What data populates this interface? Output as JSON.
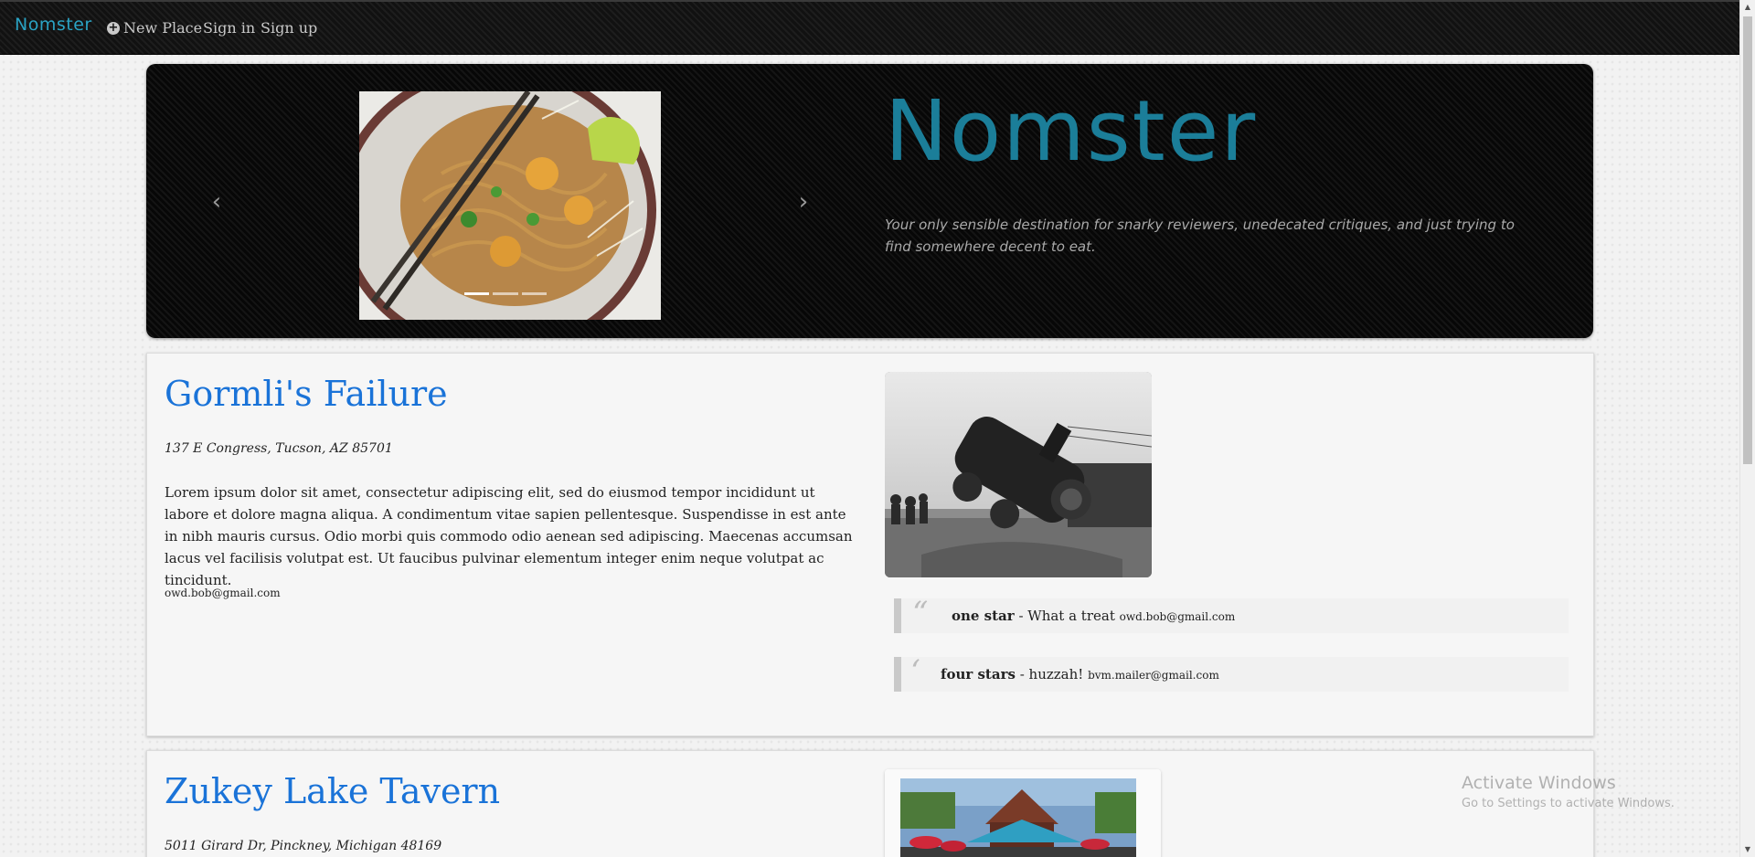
{
  "navbar": {
    "brand": "Nomster",
    "new_place": "New Place",
    "sign_in": "Sign in",
    "sign_up": "Sign up"
  },
  "hero": {
    "title": "Nomster",
    "tagline": "Your only sensible destination for snarky reviewers, unedecated critiques, and just trying to find somewhere decent to eat.",
    "carousel": {
      "prev_icon": "chevron-left-icon",
      "next_icon": "chevron-right-icon",
      "slide_count": 3,
      "active_slide": 1
    }
  },
  "places": [
    {
      "name": "Gormli's Failure",
      "address": "137 E Congress, Tucson, AZ 85701",
      "description": "Lorem ipsum dolor sit amet, consectetur adipiscing elit, sed do eiusmod tempor incididunt ut labore et dolore magna aliqua. A condimentum vitae sapien pellentesque. Suspendisse in est ante in nibh mauris cursus. Odio morbi quis commodo odio aenean sed adipiscing. Maecenas accumsan lacus vel facilisis volutpat est. Ut faucibus pulvinar elementum integer enim neque volutpat ac tincidunt.",
      "email": "owd.bob@gmail.com",
      "comments": [
        {
          "rating": "one star",
          "sep": " - ",
          "text": "What a treat",
          "email": "owd.bob@gmail.com"
        },
        {
          "rating": "four stars",
          "sep": " - ",
          "text": "huzzah!",
          "email": "bvm.mailer@gmail.com"
        }
      ]
    },
    {
      "name": "Zukey Lake Tavern",
      "address": "5011 Girard Dr, Pinckney, Michigan 48169"
    }
  ],
  "watermark": {
    "title": "Activate Windows",
    "subtitle": "Go to Settings to activate Windows."
  },
  "colors": {
    "brand": "#2aa3c4",
    "hero_title": "#1b7e99",
    "place_link": "#1a73d8"
  }
}
